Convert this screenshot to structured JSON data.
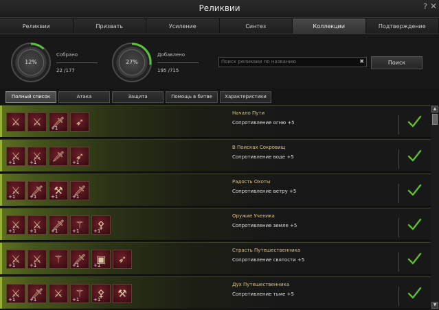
{
  "window": {
    "title": "Реликвии",
    "help": "?",
    "close": "✕"
  },
  "tabs": [
    {
      "label": "Реликвии",
      "active": false
    },
    {
      "label": "Призвать",
      "active": false
    },
    {
      "label": "Усиление",
      "active": false
    },
    {
      "label": "Синтез",
      "active": false
    },
    {
      "label": "Коллекции",
      "active": true
    },
    {
      "label": "Подтверждение",
      "active": false
    }
  ],
  "stats": {
    "collected": {
      "percent": "12%",
      "value": 0.12,
      "label": "Собрано",
      "count": "22 /177"
    },
    "added": {
      "percent": "27%",
      "value": 0.27,
      "label": "Добавлено",
      "count": "195 /715"
    }
  },
  "search": {
    "placeholder": "Поиск реликвии по названию",
    "clear": "✖",
    "button": "Поиск"
  },
  "filters": [
    {
      "label": "Полный список",
      "active": true
    },
    {
      "label": "Атака",
      "active": false
    },
    {
      "label": "Защита",
      "active": false
    },
    {
      "label": "Помощь в битве",
      "active": false
    },
    {
      "label": "Характеристики",
      "active": false
    }
  ],
  "collections": [
    {
      "name": "Начало Пути",
      "bonus": "Сопротивление огню +5",
      "items": [
        {
          "icon": "sword-icon",
          "glyph": "⚔",
          "plus": ""
        },
        {
          "icon": "crossed-swords-icon",
          "glyph": "⚔",
          "plus": ""
        },
        {
          "icon": "dagger-icon",
          "glyph": "🗡",
          "plus": "+1"
        },
        {
          "icon": "bow-icon",
          "glyph": "➶",
          "plus": ""
        }
      ]
    },
    {
      "name": "В Поисках Сокровищ",
      "bonus": "Сопротивление воде +5",
      "items": [
        {
          "icon": "sword-icon",
          "glyph": "⚔",
          "plus": "+1"
        },
        {
          "icon": "crossed-swords-icon",
          "glyph": "⚔",
          "plus": "+1"
        },
        {
          "icon": "dagger-icon",
          "glyph": "🗡",
          "plus": ""
        },
        {
          "icon": "crossbow-icon",
          "glyph": "➶",
          "plus": "+1"
        }
      ]
    },
    {
      "name": "Радость Охоты",
      "bonus": "Сопротивление ветру +5",
      "items": [
        {
          "icon": "claw-icon",
          "glyph": "⚔",
          "plus": "+1"
        },
        {
          "icon": "dagger-icon",
          "glyph": "🗡",
          "plus": "+1"
        },
        {
          "icon": "axe-icon",
          "glyph": "⚒",
          "plus": "+1"
        },
        {
          "icon": "blade-icon",
          "glyph": "🗡",
          "plus": "+1"
        }
      ]
    },
    {
      "name": "Оружие Ученика",
      "bonus": "Сопротивление земле +5",
      "items": [
        {
          "icon": "sword-icon",
          "glyph": "⚔",
          "plus": "+1"
        },
        {
          "icon": "crossed-swords-icon",
          "glyph": "⚔",
          "plus": "+1"
        },
        {
          "icon": "dagger-icon",
          "glyph": "🗡",
          "plus": "+1"
        },
        {
          "icon": "mace-icon",
          "glyph": "⚚",
          "plus": "+1"
        },
        {
          "icon": "staff-icon",
          "glyph": "⚴",
          "plus": "+1"
        }
      ]
    },
    {
      "name": "Страсть Путешественника",
      "bonus": "Сопротивление святости +5",
      "items": [
        {
          "icon": "sword-icon",
          "glyph": "⚔",
          "plus": "+1"
        },
        {
          "icon": "spear-icon",
          "glyph": "⚔",
          "plus": "+1"
        },
        {
          "icon": "mace-icon",
          "glyph": "⚚",
          "plus": ""
        },
        {
          "icon": "blade-icon",
          "glyph": "🗡",
          "plus": "+1"
        },
        {
          "icon": "shield-icon",
          "glyph": "▣",
          "plus": "+1"
        },
        {
          "icon": "crossbow-icon",
          "glyph": "➶",
          "plus": ""
        }
      ]
    },
    {
      "name": "Дух Путешественника",
      "bonus": "Сопротивление тьме +5",
      "items": [
        {
          "icon": "sword-icon",
          "glyph": "⚔",
          "plus": "+1"
        },
        {
          "icon": "dagger-icon",
          "glyph": "🗡",
          "plus": "+1"
        },
        {
          "icon": "crossed-swords-icon",
          "glyph": "⚔",
          "plus": ""
        },
        {
          "icon": "mace-icon",
          "glyph": "⚚",
          "plus": "+1"
        },
        {
          "icon": "staff-icon",
          "glyph": "⚴",
          "plus": "+1"
        },
        {
          "icon": "hammer-icon",
          "glyph": "⚒",
          "plus": ""
        }
      ]
    }
  ],
  "colors": {
    "accent_green": "#98b23a",
    "check": "#5fbf2a",
    "ring_progress": "#58c23a",
    "item_bg": "#5a1820"
  }
}
